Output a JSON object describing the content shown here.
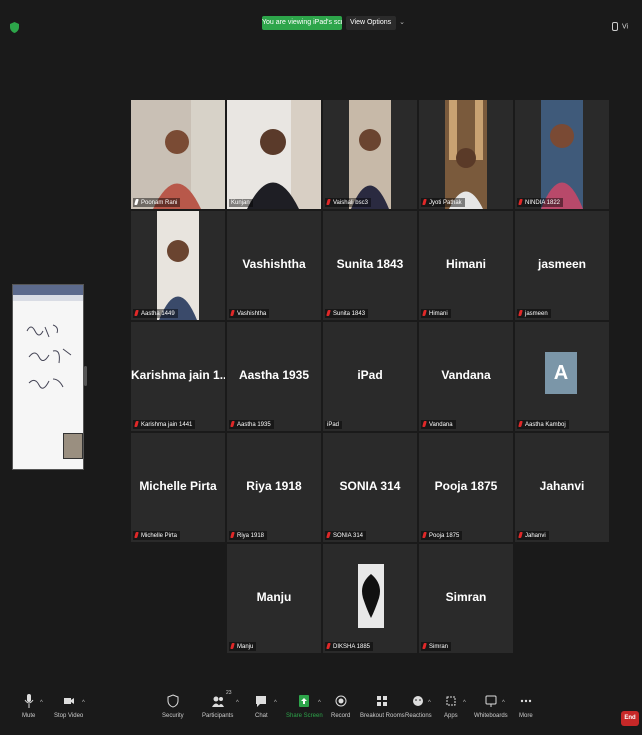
{
  "topbar": {
    "viewing_text": "You are viewing iPad's screen",
    "view_options": "View Options",
    "view_options_chevron": "⌄",
    "right_text": "Vi"
  },
  "tiles": [
    {
      "label": "Poonam Rani",
      "muted": false,
      "type": "video"
    },
    {
      "label": "Kunjan",
      "muted": false,
      "type": "video",
      "active": true
    },
    {
      "label": "Vaishali bsc3",
      "muted": true,
      "type": "video"
    },
    {
      "label": "Jyoti Pathak",
      "muted": true,
      "type": "video"
    },
    {
      "label": "NINDIA 1822",
      "muted": true,
      "type": "video"
    },
    {
      "label": "Aastha 1449",
      "muted": true,
      "type": "video"
    },
    {
      "name": "Vashishtha",
      "label": "Vashishtha",
      "muted": true
    },
    {
      "name": "Sunita 1843",
      "label": "Sunita 1843",
      "muted": true
    },
    {
      "name": "Himani",
      "label": "Himani",
      "muted": true
    },
    {
      "name": "jasmeen",
      "label": "jasmeen",
      "muted": true
    },
    {
      "name": "Karishma jain 1...",
      "label": "Karishma jain 1441",
      "muted": true
    },
    {
      "name": "Aastha 1935",
      "label": "Aastha 1935",
      "muted": true
    },
    {
      "name": "iPad",
      "label": "iPad",
      "muted": false
    },
    {
      "name": "Vandana",
      "label": "Vandana",
      "muted": true
    },
    {
      "avatar": "A",
      "label": "Aastha Kamboj",
      "muted": true
    },
    {
      "name": "Michelle Pirta",
      "label": "Michelle Pirta",
      "muted": true
    },
    {
      "name": "Riya 1918",
      "label": "Riya 1918",
      "muted": true
    },
    {
      "name": "SONIA 314",
      "label": "SONIA 314",
      "muted": true
    },
    {
      "name": "Pooja 1875",
      "label": "Pooja 1875",
      "muted": true
    },
    {
      "name": "Jahanvi",
      "label": "Jahanvi",
      "muted": true
    },
    {
      "name": "Manju",
      "label": "Manju",
      "muted": true
    },
    {
      "label": "DIKSHA 1885",
      "muted": true,
      "type": "image"
    },
    {
      "name": "Simran",
      "label": "Simran",
      "muted": true
    }
  ],
  "toolbar": {
    "mute": "Mute",
    "stop_video": "Stop Video",
    "security": "Security",
    "participants": "Participants",
    "participants_count": "23",
    "chat": "Chat",
    "share_screen": "Share Screen",
    "record": "Record",
    "breakout_rooms": "Breakout Rooms",
    "reactions": "Reactions",
    "apps": "Apps",
    "whiteboards": "Whiteboards",
    "more": "More",
    "end": "End"
  },
  "colors": {
    "background": "#1a1a1a",
    "tile": "#2a2a2a",
    "share_green": "#2da54a",
    "end_red": "#c62828",
    "mute_red": "#e02828",
    "active_outline": "#c8d24a"
  }
}
